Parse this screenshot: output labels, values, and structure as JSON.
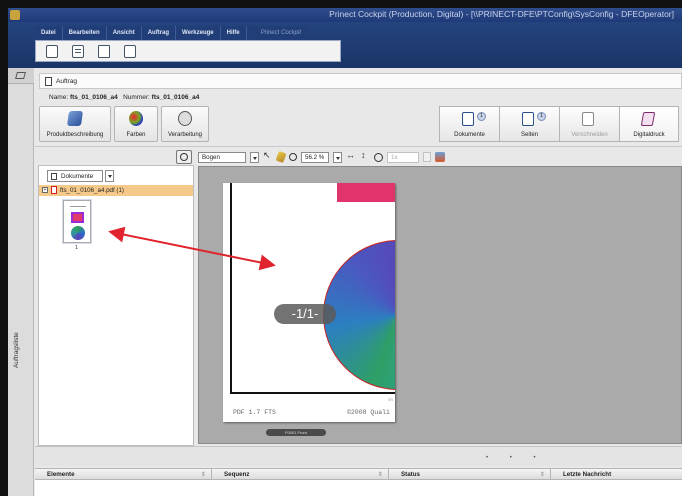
{
  "window": {
    "title": "Prinect Cockpit (Production, Digital) - [\\\\PRINECT-DFE\\PTConfig\\SysConfig - DFEOperator]"
  },
  "menu": {
    "items": [
      "Datei",
      "Bearbeiten",
      "Ansicht",
      "Auftrag",
      "Werkzeuge",
      "Hilfe"
    ],
    "brand": "Prinect Cockpit"
  },
  "sidebar": {
    "vertical_label": "Auftragsliste"
  },
  "job": {
    "tab_label": "Auftrag",
    "name_label": "Name:",
    "name_value": "fts_01_0106_a4",
    "number_label": "Nummer:",
    "number_value": "fts_01_0106_a4"
  },
  "left_buttons": [
    {
      "label": "Produktbeschreibung"
    },
    {
      "label": "Farben"
    },
    {
      "label": "Verarbeitung"
    }
  ],
  "workflow_steps": [
    {
      "label": "Dokumente",
      "badge": "1"
    },
    {
      "label": "Seiten",
      "badge": "1"
    },
    {
      "label": "Verschneiden",
      "badge": ""
    },
    {
      "label": "Digitaldruck",
      "badge": ""
    }
  ],
  "document_pane": {
    "dropdown_label": "Dokumente",
    "file_name": "fts_01_0106_a4.pdf (1)",
    "thumb_page_number": "1"
  },
  "viewer_toolbar": {
    "view_select": "Bogen",
    "zoom": "56.2 %",
    "disabled_field": "1x"
  },
  "viewer": {
    "page_badge": "-1/1-",
    "footer_left": "PDF 1.7 FTS",
    "footer_right": "©2008 Quali",
    "footer_small": "0S",
    "frame_label": "F0001 Front"
  },
  "table": {
    "columns": [
      "Elemente",
      "Sequenz",
      "Status",
      "Letzte Nachricht"
    ]
  },
  "colors": {
    "title_bar": "#1f3a78",
    "selected_row": "#f5c98a",
    "annotation_arrow": "#e0232c",
    "page_accent": "#e0346a"
  }
}
